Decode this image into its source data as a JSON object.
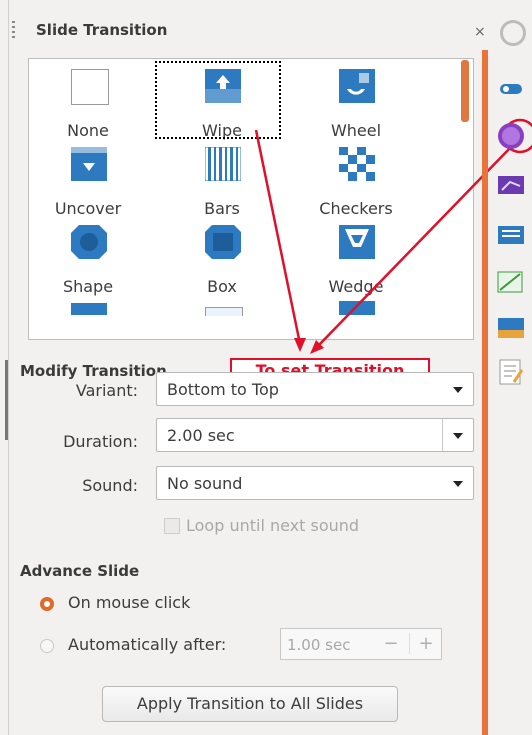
{
  "panel": {
    "title": "Slide Transition",
    "close_label": "×"
  },
  "gallery": {
    "items": [
      {
        "label": "None",
        "icon": "none-thumbnail-icon"
      },
      {
        "label": "Wipe",
        "icon": "wipe-thumbnail-icon"
      },
      {
        "label": "Wheel",
        "icon": "wheel-thumbnail-icon"
      },
      {
        "label": "Uncover",
        "icon": "uncover-thumbnail-icon"
      },
      {
        "label": "Bars",
        "icon": "bars-thumbnail-icon"
      },
      {
        "label": "Checkers",
        "icon": "checkers-thumbnail-icon"
      },
      {
        "label": "Shape",
        "icon": "shape-thumbnail-icon"
      },
      {
        "label": "Box",
        "icon": "box-thumbnail-icon"
      },
      {
        "label": "Wedge",
        "icon": "wedge-thumbnail-icon"
      }
    ],
    "selected": "Wipe"
  },
  "annotation": {
    "text": "To set Transition",
    "color": "#e0102a"
  },
  "modify": {
    "heading": "Modify Transition",
    "variant_label": "Variant:",
    "variant_value": "Bottom to Top",
    "duration_label": "Duration:",
    "duration_value": "2.00 sec",
    "sound_label": "Sound:",
    "sound_value": "No sound",
    "loop_label": "Loop until next sound"
  },
  "advance": {
    "heading": "Advance Slide",
    "on_click_label": "On mouse click",
    "auto_label": "Automatically after:",
    "auto_value": "1.00 sec",
    "minus": "−",
    "plus": "+",
    "selected": "On mouse click"
  },
  "apply_button": "Apply Transition to All Slides",
  "colors": {
    "accent": "#e8743b",
    "thumb_blue": "#2d7ac1",
    "annotation_red": "#e0102a"
  },
  "sidebar_icons": [
    "gear-icon",
    "properties-icon",
    "slide-transition-icon",
    "animation-icon",
    "master-slides-icon",
    "styles-icon",
    "gallery-icon",
    "navigator-icon"
  ]
}
